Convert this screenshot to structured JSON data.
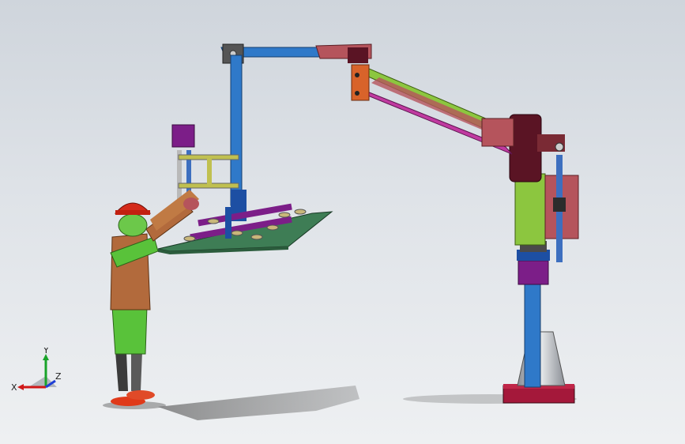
{
  "triad": {
    "x_label": "X",
    "y_label": "Y",
    "z_label": "Z",
    "colors": {
      "x": "#d01818",
      "y": "#19a32a",
      "z": "#1e3fd6"
    }
  }
}
